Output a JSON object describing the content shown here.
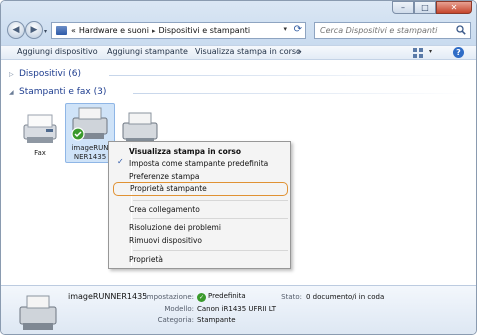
{
  "window": {
    "controls": {
      "minimize": "–",
      "maximize": "□",
      "close": "✕"
    }
  },
  "nav": {
    "back_glyph": "◀",
    "forward_glyph": "▶",
    "drop_glyph": "▾"
  },
  "address": {
    "overflow": "«",
    "crumbs": [
      "Hardware e suoni",
      "Dispositivi e stampanti"
    ],
    "separator": "▸",
    "drop_glyph": "▾",
    "refresh_glyph": "⟳"
  },
  "search": {
    "placeholder": "Cerca Dispositivi e stampanti"
  },
  "toolbar": {
    "items": [
      "Aggiungi dispositivo",
      "Aggiungi stampante",
      "Visualizza stampa in corso"
    ],
    "more": "»",
    "view_drop": "▾",
    "help": "?"
  },
  "groups": {
    "devices": {
      "title": "Dispositivi (6)",
      "expanded": false,
      "glyph": "▷"
    },
    "printers": {
      "title": "Stampanti e fax (3)",
      "expanded": true,
      "glyph": "◢"
    }
  },
  "printers": [
    {
      "label": "Fax",
      "icon": "fax-icon"
    },
    {
      "label": "imageRUN NER1435",
      "label_lines": [
        "imageRUN",
        "NER1435"
      ],
      "icon": "printer-icon",
      "default": true,
      "selected": true
    },
    {
      "label": "",
      "icon": "printer-icon"
    }
  ],
  "context_menu": {
    "items": [
      {
        "label": "Visualizza stampa in corso",
        "bold": true
      },
      {
        "label": "Imposta come stampante predefinita",
        "checked": true
      },
      {
        "label": "Preferenze stampa"
      },
      {
        "label": "Proprietà stampante",
        "highlighted": true
      },
      {
        "label": "Crea collegamento"
      },
      {
        "label": "Risoluzione dei problemi"
      },
      {
        "label": "Rimuovi dispositivo"
      },
      {
        "label": "Proprietà"
      }
    ],
    "check_glyph": "✓"
  },
  "details": {
    "name": "imageRUNNER1435",
    "fields": {
      "setting_label": "Impostazione:",
      "setting_value": "Predefinita",
      "model_label": "Modello:",
      "model_value": "Canon iR1435 UFRII LT",
      "category_label": "Categoria:",
      "category_value": "Stampante",
      "status_label": "Stato:",
      "status_value": "0 documento/i in coda"
    },
    "ok_glyph": "✓"
  },
  "colors": {
    "accent_link": "#1e3d8f",
    "highlight_border": "#e09234",
    "default_check": "#3a9a2c"
  }
}
